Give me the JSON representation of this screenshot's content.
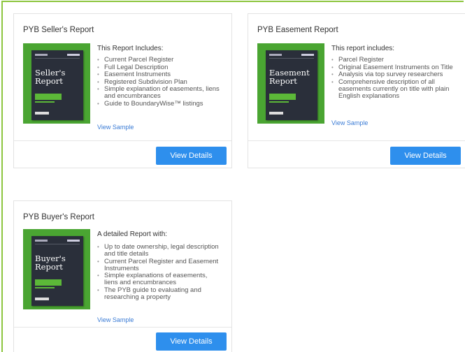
{
  "cards": [
    {
      "title": "PYB Seller's Report",
      "cover_title": [
        "Seller's",
        "Report"
      ],
      "intro": "This Report Includes:",
      "bullets": [
        "Current Parcel Register",
        "Full Legal Description",
        "Easement Instruments",
        "Registered Subdivision Plan",
        "Simple explanation of easements, liens and encumbrances",
        "Guide to BoundaryWise™ listings"
      ],
      "sample_link": "View Sample",
      "button_label": "View Details"
    },
    {
      "title": "PYB Easement Report",
      "cover_title": [
        "Easement",
        "Report"
      ],
      "intro": "This report includes:",
      "bullets": [
        "Parcel Register",
        "Original Easement Instruments on Title",
        "Analysis via top survey researchers",
        "Comprehensive description of all easements currently on title with plain English explanations"
      ],
      "sample_link": "View Sample",
      "button_label": "View Details"
    },
    {
      "title": "PYB Buyer's Report",
      "cover_title": [
        "Buyer's",
        "Report"
      ],
      "intro": "A detailed Report with:",
      "bullets": [
        "Up to date ownership, legal description and title details",
        "Current Parcel Register and Easement Instruments",
        "Simple explanations of easements, liens and encumbrances",
        "The PYB guide to evaluating and researching a property"
      ],
      "sample_link": "View Sample",
      "button_label": "View Details"
    }
  ],
  "colors": {
    "accent_green": "#8dc63f",
    "button_blue": "#2e8fed",
    "link_blue": "#3a7bd5",
    "cover_green": "#4aa532"
  },
  "icons": {
    "cover": "report-cover-image"
  }
}
